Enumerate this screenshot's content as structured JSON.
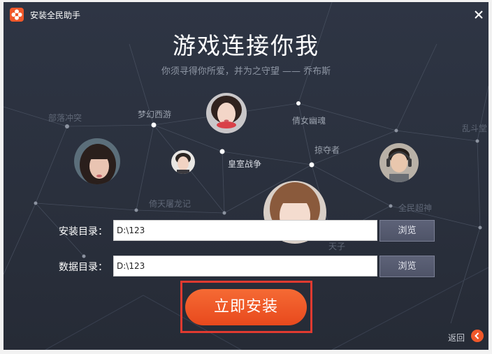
{
  "window": {
    "title": "安装全民助手"
  },
  "hero": {
    "headline": "游戏连接你我",
    "quote": "你须寻得你所爱，并为之守望 —— 乔布斯"
  },
  "games": [
    {
      "name": "部落冲突"
    },
    {
      "name": "梦幻西游"
    },
    {
      "name": "倩女幽魂"
    },
    {
      "name": "乱斗堂"
    },
    {
      "name": "掠夺者"
    },
    {
      "name": "皇室战争"
    },
    {
      "name": "倚天屠龙记"
    },
    {
      "name": "全民超神"
    },
    {
      "name": "天子"
    }
  ],
  "form": {
    "install_dir": {
      "label": "安装目录：",
      "value": "D:\\123"
    },
    "data_dir": {
      "label": "数据目录：",
      "value": "D:\\123"
    },
    "browse_label": "浏览"
  },
  "actions": {
    "install_label": "立即安装",
    "back_label": "返回"
  },
  "colors": {
    "accent": "#f0582a",
    "background": "#2b313e",
    "highlight_frame": "#e03a30"
  },
  "icons": [
    "app-logo-icon",
    "close-icon",
    "back-arrow-icon"
  ]
}
